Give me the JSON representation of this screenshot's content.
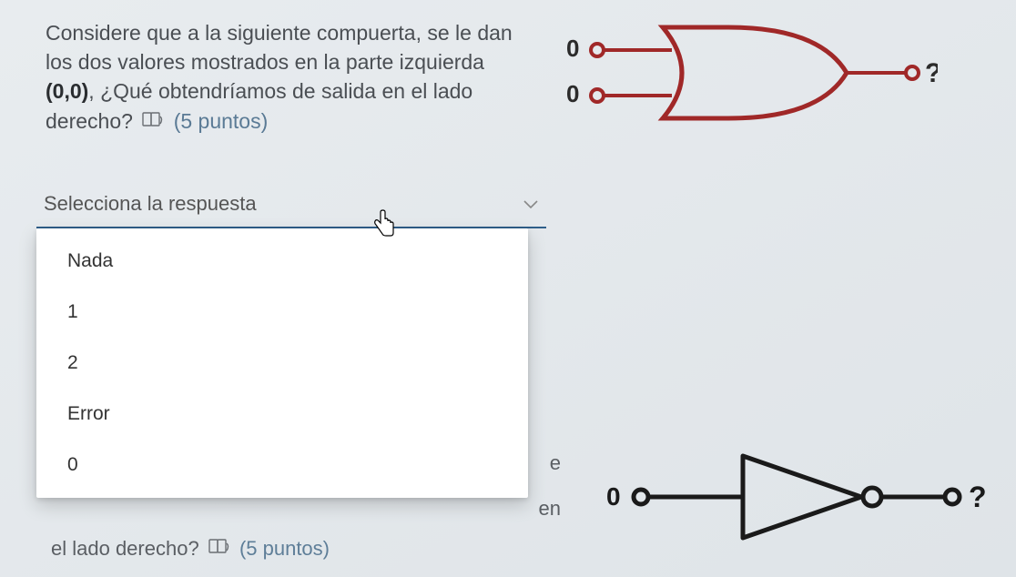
{
  "question1": {
    "text_part1": "Considere que a la siguiente compuerta, se le dan los dos valores mostrados en la parte izquierda ",
    "bold_inputs": "(0,0)",
    "text_part2": ", ¿Qué obtendríamos de salida en el lado derecho?",
    "points": "(5 puntos)",
    "input_top": "0",
    "input_bottom": "0",
    "output_mark": "?"
  },
  "dropdown": {
    "placeholder": "Selecciona la respuesta",
    "options": [
      "Nada",
      "1",
      "2",
      "Error",
      "0"
    ]
  },
  "question2": {
    "fragment_e": "e",
    "fragment_en": "en",
    "text_tail": "el lado derecho?",
    "points": "(5 puntos)",
    "input": "0",
    "output_mark": "?"
  }
}
